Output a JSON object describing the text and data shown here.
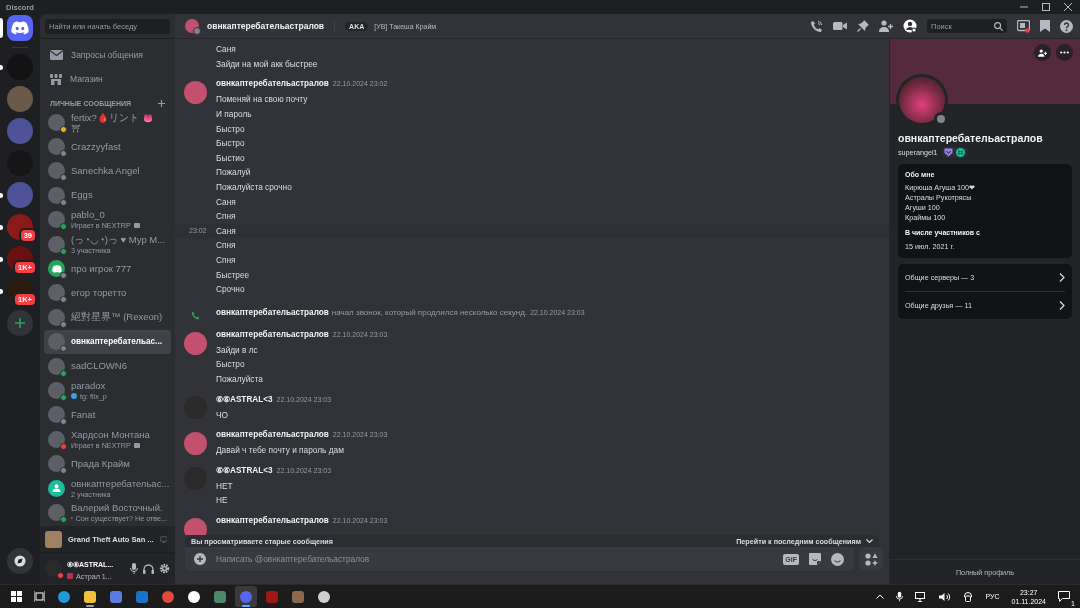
{
  "window": {
    "title": "Discord"
  },
  "home": {
    "selected": true
  },
  "servers": [
    {
      "color": "#121212",
      "unread": true
    },
    {
      "color": "#6b5a4a",
      "unread": false
    },
    {
      "color": "#4e5399",
      "unread": false
    },
    {
      "color": "#151515",
      "unread": false
    },
    {
      "color": "#4e5399",
      "unread": true
    },
    {
      "color": "#8a1a1a",
      "unread": true,
      "badge": "39"
    },
    {
      "color": "#6a1010",
      "unread": true,
      "badge": "1K+"
    },
    {
      "color": "#2a1a10",
      "unread": true,
      "badge": "1K+"
    }
  ],
  "dm_sidebar": {
    "search": {
      "placeholder": "Найти или начать беседу"
    },
    "nav": [
      {
        "kind": "requests",
        "label": "Запросы общения"
      },
      {
        "kind": "shop",
        "label": "Магазин"
      }
    ],
    "section_title": "ЛИЧНЫЕ СООБЩЕНИЯ",
    "conversations": [
      {
        "kind": "user",
        "name": "fertix?🩸リント 👅",
        "subtitle": {
          "kind": "plain",
          "text": "⛩"
        },
        "color": "#f0b232",
        "selected": false
      },
      {
        "kind": "user",
        "name": "Crazzyyfast",
        "color": "#80848e",
        "selected": false
      },
      {
        "kind": "user",
        "name": "Sanechka Angel",
        "color": "#80848e",
        "selected": false
      },
      {
        "kind": "user",
        "name": "Eggs",
        "color": "#80848e",
        "selected": false
      },
      {
        "kind": "user",
        "name": "pablo_0",
        "subtitle": {
          "kind": "playing",
          "text": "Играет в NEXTRP"
        },
        "color": "#23a55a",
        "selected": false
      },
      {
        "kind": "user",
        "name": "(っ◔◡◔)っ ♥ Мур М...",
        "subtitle": {
          "kind": "plain",
          "text": "3 участника"
        },
        "color": "#23a55a",
        "selected": false
      },
      {
        "kind": "default",
        "name": "про игрок 777",
        "color": "#80848e",
        "selected": false
      },
      {
        "kind": "user",
        "name": "егор торетто",
        "color": "#80848e",
        "selected": false
      },
      {
        "kind": "user",
        "name": "絕對星界™ (Rexeon)",
        "color": "#80848e",
        "selected": false
      },
      {
        "kind": "user",
        "name": "овнкаптеребательас...",
        "color": "#80848e",
        "selected": true
      },
      {
        "kind": "user",
        "name": "sadCLOWN6",
        "color": "#23a55a",
        "selected": false
      },
      {
        "kind": "user",
        "name": "paradox",
        "subtitle": {
          "kind": "custom",
          "text": "tg: flix_p"
        },
        "color": "#23a55a",
        "selected": false
      },
      {
        "kind": "user",
        "name": "Fanat",
        "color": "#80848e",
        "selected": false
      },
      {
        "kind": "user",
        "name": "Хардсон Монтана",
        "subtitle": {
          "kind": "playing",
          "text": "Играет в NEXTRP"
        },
        "color": "#f23f43",
        "selected": false
      },
      {
        "kind": "user",
        "name": "Прада Крайм",
        "color": "#80848e",
        "selected": false
      },
      {
        "kind": "group",
        "name": "овнкаптеребательас...",
        "subtitle": {
          "kind": "plain",
          "text": "2 участника"
        },
        "selected": false
      },
      {
        "kind": "user",
        "name": "Валерий Восточный.",
        "subtitle": {
          "kind": "custom",
          "text": "Сон существует? Не отве..."
        },
        "color": "#23a55a",
        "selected": false
      }
    ]
  },
  "activity": {
    "title": "Grand Theft Auto San ..."
  },
  "user_panel": {
    "name": "⑥⑥ASTRAL...",
    "status_text": "Астрал 1...",
    "status": {
      "color": "#f23f43"
    }
  },
  "chat": {
    "header": {
      "name": "овнкаптеребательастралов",
      "status": {
        "color": "#80848e"
      },
      "aka_label": "AKA",
      "alias": "[УВ] Такеша Крайм",
      "search_placeholder": "Поиск"
    },
    "messages": [
      {
        "kind": "lines",
        "lines": [
          {
            "text": "Саня"
          },
          {
            "text": "Зайди на мой акк быстрее"
          }
        ]
      },
      {
        "kind": "group",
        "author": "овнкаптеребательастралов",
        "time": "22.10.2024 23:02",
        "color": "#c2506e",
        "lines": [
          {
            "text": "Поменяй на свою почту"
          },
          {
            "text": "И пароль"
          },
          {
            "text": "Быстро"
          },
          {
            "text": "Быстро"
          },
          {
            "text": "Быстио"
          },
          {
            "text": "Пожалуй"
          },
          {
            "text": "Пожалуйста срочно"
          },
          {
            "text": "Саня"
          },
          {
            "text": "Спня"
          },
          {
            "text": "Саня",
            "hover_time": "23:02"
          },
          {
            "text": "Спня"
          },
          {
            "text": "Спня"
          },
          {
            "text": "Быстрее"
          },
          {
            "text": "Срочно"
          }
        ]
      },
      {
        "kind": "call",
        "author": "овнкаптеребательастралов",
        "text": "начал звонок, который продлился несколько секунд.",
        "time": "22.10.2024 23:03"
      },
      {
        "kind": "group",
        "author": "овнкаптеребательастралов",
        "time": "22.10.2024 23:03",
        "color": "#c2506e",
        "lines": [
          {
            "text": "Зайди в лс"
          },
          {
            "text": "Быстро"
          },
          {
            "text": "Пожалуйста"
          }
        ]
      },
      {
        "kind": "group",
        "author": "⑥⑥ASTRAL<3",
        "time": "22.10.2024 23:03",
        "color": "#2a2a2a",
        "lines": [
          {
            "text": "ЧО"
          }
        ]
      },
      {
        "kind": "group",
        "author": "овнкаптеребательастралов",
        "time": "22.10.2024 23:03",
        "color": "#c2506e",
        "lines": [
          {
            "text": "Давай ч тебе почту и пароль дам"
          }
        ]
      },
      {
        "kind": "group",
        "author": "⑥⑥ASTRAL<3",
        "time": "22.10.2024 23:03",
        "color": "#2a2a2a",
        "lines": [
          {
            "text": "НЕТ"
          },
          {
            "text": "НЕ"
          }
        ]
      },
      {
        "kind": "group",
        "author": "овнкаптеребательастралов",
        "time": "22.10.2024 23:03",
        "color": "#c2506e"
      }
    ],
    "jump_bar": {
      "text": "Вы просматриваете старые сообщения",
      "action": "Перейти к последним сообщениям"
    },
    "composer": {
      "placeholder": "Написать @овнкаптеребательастралов",
      "gif_label": "GIF"
    }
  },
  "profile": {
    "status": {
      "color": "#80848e"
    },
    "name": "овнкаптеребательастралов",
    "username": "superangel1",
    "about_title": "Обо мне",
    "about_lines": [
      "Кирюша Агуша 100❤",
      "Астралы Рукотрясы",
      "Агуши 100",
      "Краймы 100"
    ],
    "member_since_title": "В числе участников с",
    "member_since": "15 июл. 2021 г.",
    "mutual": [
      {
        "label": "Общие серверы — 3"
      },
      {
        "label": "Общие друзья — 11"
      }
    ],
    "full_profile": "Полный профиль"
  },
  "taskbar": {
    "apps": [
      {
        "kind": "edge",
        "selected": false,
        "running": false
      },
      {
        "kind": "explorer",
        "selected": false,
        "running": true
      },
      {
        "kind": "store",
        "selected": false,
        "running": false
      },
      {
        "kind": "outlook",
        "selected": false,
        "running": false
      },
      {
        "kind": "chrome",
        "selected": false,
        "running": false
      },
      {
        "kind": "yandex",
        "selected": false,
        "running": false
      },
      {
        "kind": "viewer",
        "selected": false,
        "running": false
      },
      {
        "kind": "discord",
        "selected": true,
        "running": true
      },
      {
        "kind": "game",
        "selected": false,
        "running": false
      },
      {
        "kind": "photo",
        "selected": false,
        "running": false
      },
      {
        "kind": "steam",
        "selected": false,
        "running": false
      }
    ],
    "language": "РУС",
    "time": "23:27",
    "date": "01.11.2024",
    "notifications": "1"
  }
}
